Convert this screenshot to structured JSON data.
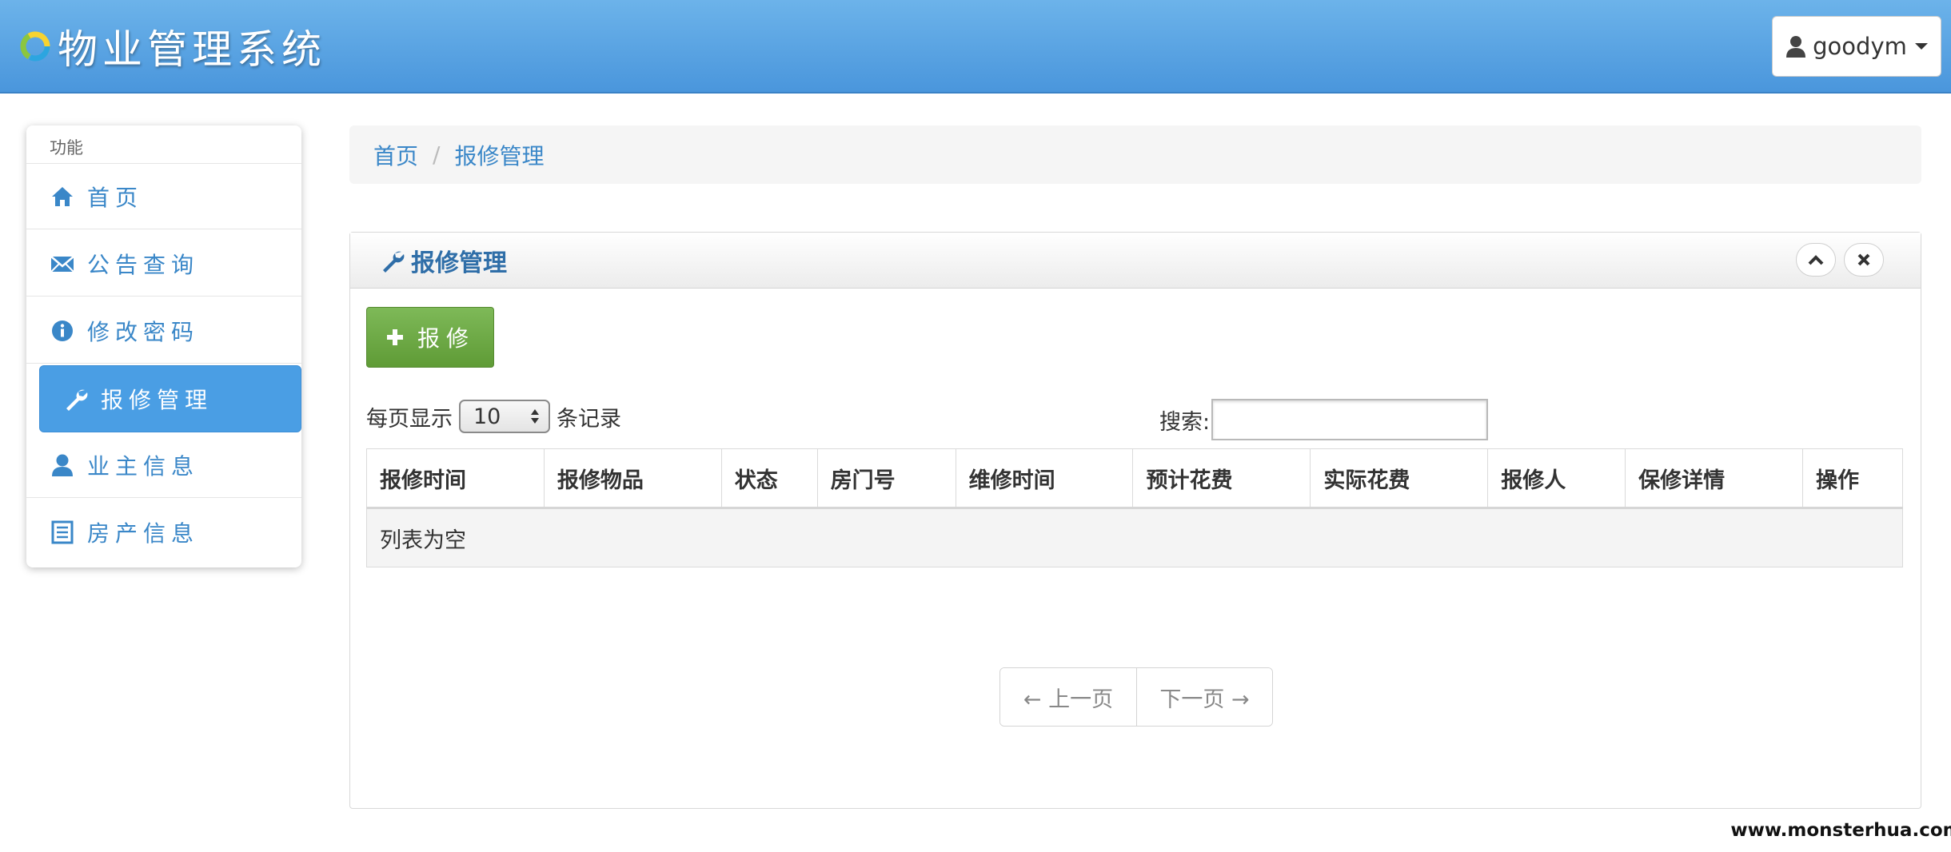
{
  "header": {
    "app_title": "物业管理系统",
    "username": "goodym"
  },
  "sidebar": {
    "section_label": "功能",
    "items": [
      {
        "label": "首页",
        "icon": "home-icon"
      },
      {
        "label": "公告查询",
        "icon": "envelope-icon"
      },
      {
        "label": "修改密码",
        "icon": "info-icon"
      },
      {
        "label": "报修管理",
        "icon": "wrench-icon",
        "active": true
      },
      {
        "label": "业主信息",
        "icon": "user-icon"
      },
      {
        "label": "房产信息",
        "icon": "list-icon"
      }
    ]
  },
  "breadcrumb": {
    "home": "首页",
    "separator": "/",
    "current": "报修管理"
  },
  "panel": {
    "title": "报修管理",
    "add_button": "报修",
    "length_prefix": "每页显示",
    "length_value": "10",
    "length_suffix": "条记录",
    "search_label": "搜索:",
    "search_value": "",
    "columns": [
      "报修时间",
      "报修物品",
      "状态",
      "房门号",
      "维修时间",
      "预计花费",
      "实际花费",
      "报修人",
      "保修详情",
      "操作"
    ],
    "empty_text": "列表为空",
    "prev_page": "← 上一页",
    "next_page": "下一页 →"
  },
  "watermark": "www.monsterhua.com",
  "colors": {
    "navbar": "#4a96dc",
    "accent": "#4a9ee4",
    "link": "#3a87c8",
    "add_button": "#6aa843"
  }
}
